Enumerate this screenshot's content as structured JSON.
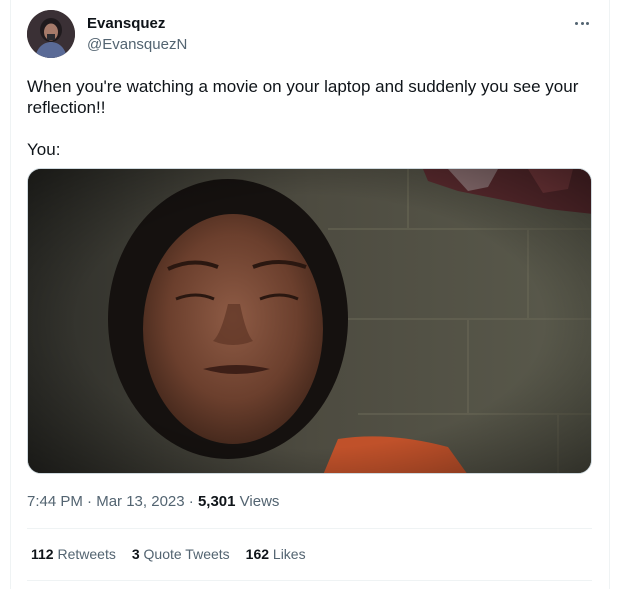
{
  "author": {
    "display_name": "Evansquez",
    "handle": "@EvansquezN"
  },
  "more_icon": "more-dots-icon",
  "tweet": {
    "text": "When you're watching a movie on your laptop and suddenly you see your reflection!!\n\nYou:"
  },
  "timestamp": {
    "time": "7:44 PM",
    "sep1": " · ",
    "date": "Mar 13, 2023",
    "sep2": " · ",
    "views_count": "5,301",
    "views_label": " Views"
  },
  "stats": {
    "retweets_count": "112",
    "retweets_label": " Retweets",
    "quotes_count": "3",
    "quotes_label": " Quote Tweets",
    "likes_count": "162",
    "likes_label": " Likes"
  },
  "colors": {
    "text_primary": "#0f1419",
    "text_secondary": "#536471",
    "divider": "#eff3f4"
  }
}
